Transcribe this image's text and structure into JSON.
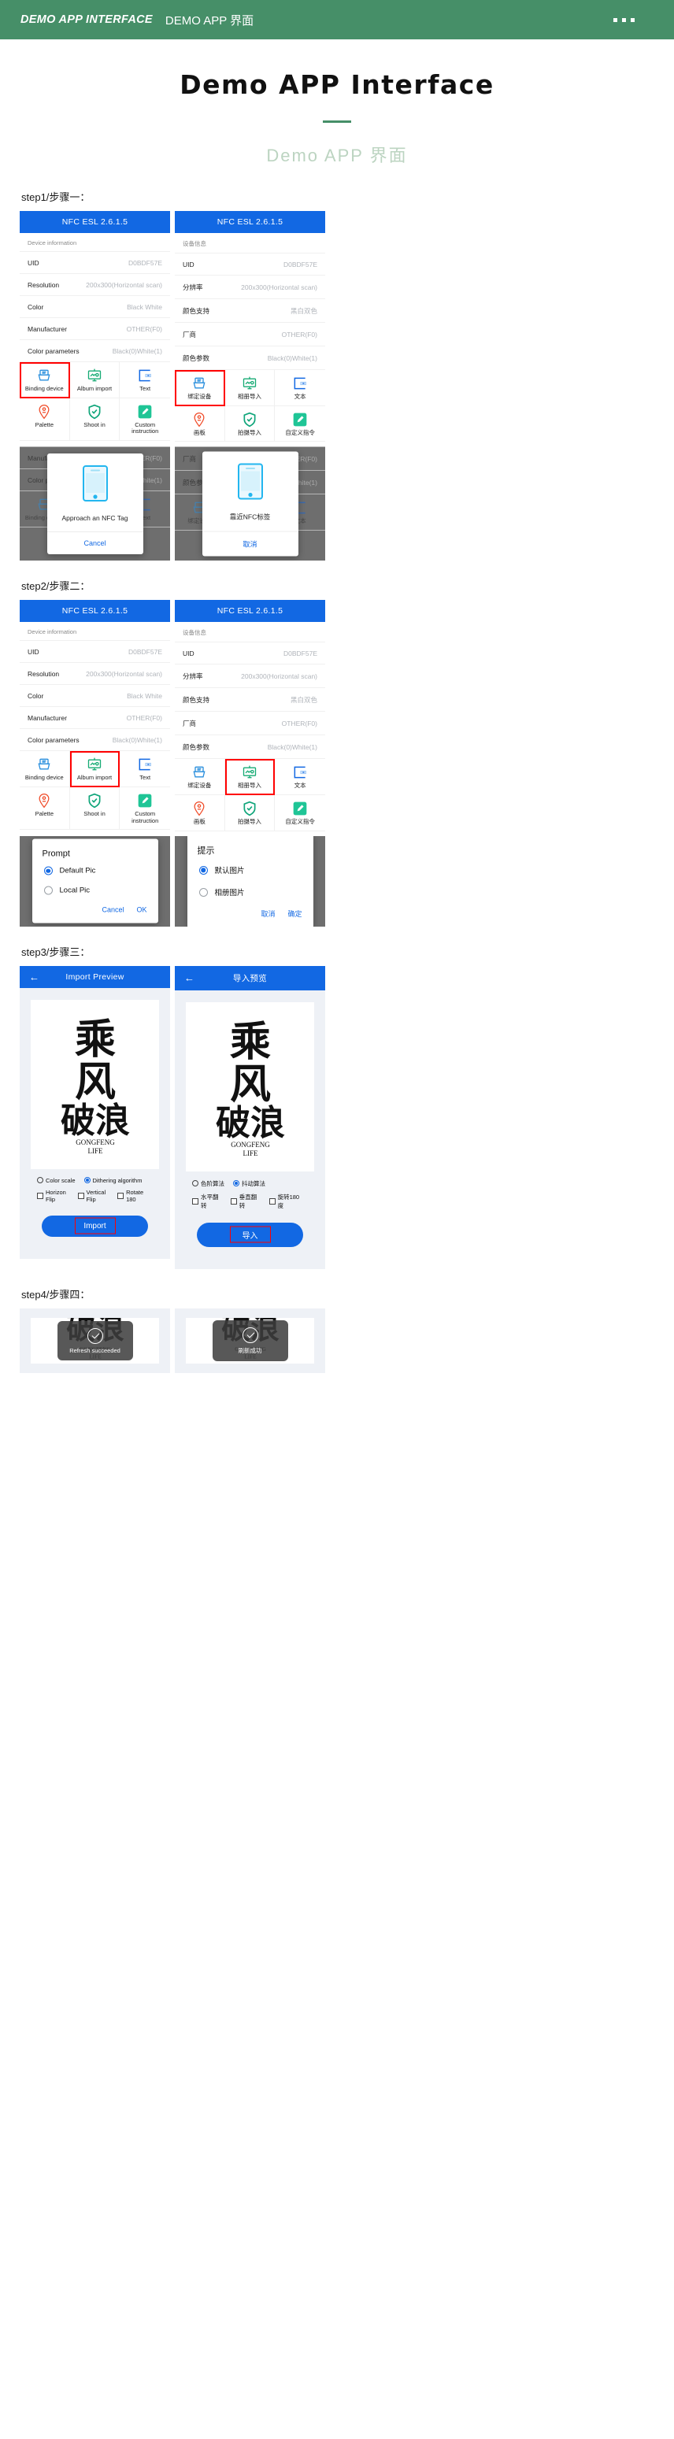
{
  "topbar": {
    "title_en": "DEMO APP INTERFACE",
    "title_cn": "DEMO APP 界面",
    "menu_icon": "more-dots-icon"
  },
  "hero": {
    "title": "Demo APP Interface",
    "subtitle": "Demo APP 界面"
  },
  "steps": {
    "step1_label": "step1/步骤一：",
    "step2_label": "step2/步骤二：",
    "step3_label": "step3/步骤三：",
    "step4_label": "step4/步骤四："
  },
  "app": {
    "header_title": "NFC ESL  2.6.1.5",
    "section_caption_en": "Device information",
    "section_caption_cn": "设备信息",
    "rows_en": [
      {
        "key": "UID",
        "value": "D0BDF57E"
      },
      {
        "key": "Resolution",
        "value": "200x300(Horizontal scan)"
      },
      {
        "key": "Color",
        "value": "Black White"
      },
      {
        "key": "Manufacturer",
        "value": "OTHER(F0)"
      },
      {
        "key": "Color parameters",
        "value": "Black(0)White(1)"
      }
    ],
    "rows_cn": [
      {
        "key": "UID",
        "value": "D0BDF57E"
      },
      {
        "key": "分辨率",
        "value": "200x300(Horizontal scan)"
      },
      {
        "key": "颜色支持",
        "value": "黑白双色"
      },
      {
        "key": "厂商",
        "value": "OTHER(F0)"
      },
      {
        "key": "颜色参数",
        "value": "Black(0)White(1)"
      }
    ],
    "tiles_en": [
      {
        "label": "Binding device",
        "icon": "printer-icon"
      },
      {
        "label": "Album import",
        "icon": "monitor-wave-icon"
      },
      {
        "label": "Text",
        "icon": "text-box-icon"
      },
      {
        "label": "Palette",
        "icon": "palette-pin-icon"
      },
      {
        "label": "Shoot in",
        "icon": "shield-check-icon"
      },
      {
        "label": "Custom instruction",
        "icon": "pencil-icon"
      }
    ],
    "tiles_cn": [
      {
        "label": "绑定设备",
        "icon": "printer-icon"
      },
      {
        "label": "相册导入",
        "icon": "monitor-wave-icon"
      },
      {
        "label": "文本",
        "icon": "text-box-icon"
      },
      {
        "label": "画板",
        "icon": "palette-pin-icon"
      },
      {
        "label": "拍摄导入",
        "icon": "shield-check-icon"
      },
      {
        "label": "自定义指令",
        "icon": "pencil-icon"
      }
    ]
  },
  "nfc_dialog": {
    "text_en": "Approach an NFC Tag",
    "text_cn": "靠近NFC标签",
    "cancel_en": "Cancel",
    "cancel_cn": "取消",
    "icon": "phone-nfc-icon"
  },
  "prompt_dialog": {
    "title_en": "Prompt",
    "title_cn": "提示",
    "option1_en": "Default Pic",
    "option2_en": "Local Pic",
    "option1_cn": "默认图片",
    "option2_cn": "相册图片",
    "cancel_en": "Cancel",
    "ok_en": "OK",
    "cancel_cn": "取消",
    "ok_cn": "确定"
  },
  "preview": {
    "header_en": "Import Preview",
    "header_cn": "导入预览",
    "back_icon": "arrow-left-icon",
    "image_main_chars": "乘风破浪",
    "image_caption_top": "GONGFENG",
    "image_caption_bottom": "LIFE",
    "options_en": {
      "radio1": "Color scale",
      "radio2": "Dithering algorithm",
      "check1": "Horizon Flip",
      "check2": "Vertical Flip",
      "check3": "Rotate 180"
    },
    "options_cn": {
      "radio1": "色阶算法",
      "radio2": "抖动算法",
      "check1": "水平翻转",
      "check2": "垂直翻转",
      "check3": "旋转180度"
    },
    "import_en": "Import",
    "import_cn": "导入"
  },
  "toast": {
    "text_en": "Refresh succeeded",
    "text_cn": "刷新成功",
    "icon": "check-circle-icon"
  },
  "colors": {
    "brand_green": "#468f68",
    "app_blue": "#1268e3",
    "highlight_red": "#ff0000",
    "muted_grey": "#b0b4ba"
  }
}
